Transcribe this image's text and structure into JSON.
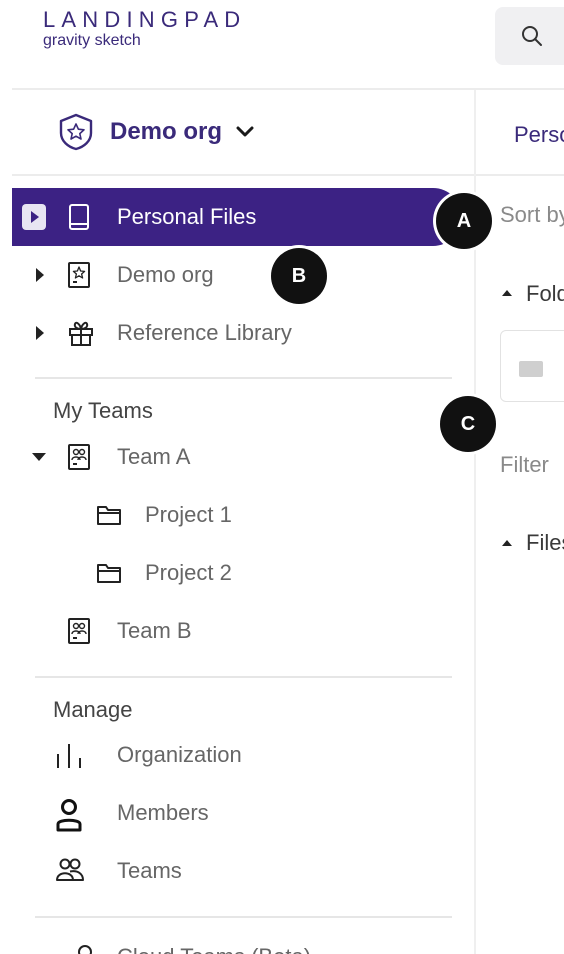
{
  "logo": {
    "main": "LANDINGPAD",
    "sub": "gravity sketch"
  },
  "org": {
    "name": "Demo org"
  },
  "nav": {
    "primary": [
      {
        "label": "Personal Files",
        "icon": "tablet-icon",
        "active": true
      },
      {
        "label": "Demo org",
        "icon": "org-star-icon",
        "active": false
      },
      {
        "label": "Reference Library",
        "icon": "gift-icon",
        "active": false
      }
    ],
    "teams_title": "My Teams",
    "teams": [
      {
        "label": "Team A",
        "icon": "team-icon",
        "expanded": true,
        "children": [
          {
            "label": "Project 1",
            "icon": "folder-icon"
          },
          {
            "label": "Project 2",
            "icon": "folder-icon"
          }
        ]
      },
      {
        "label": "Team B",
        "icon": "team-icon",
        "expanded": false
      }
    ],
    "manage_title": "Manage",
    "manage": [
      {
        "label": "Organization",
        "icon": "bar-chart-icon"
      },
      {
        "label": "Members",
        "icon": "person-icon"
      },
      {
        "label": "Teams",
        "icon": "people-icon"
      }
    ],
    "bottom_partial": "Cloud Teams (Beta)"
  },
  "main": {
    "tab": "Personal Files",
    "sort_label": "Sort by",
    "folders_label": "Folders",
    "filter_label": "Filter",
    "files_label": "Files"
  },
  "badges": [
    "A",
    "B",
    "C"
  ],
  "colors": {
    "brand": "#3c2284",
    "brand_text": "#3a2a7a",
    "badge": "#111111"
  }
}
